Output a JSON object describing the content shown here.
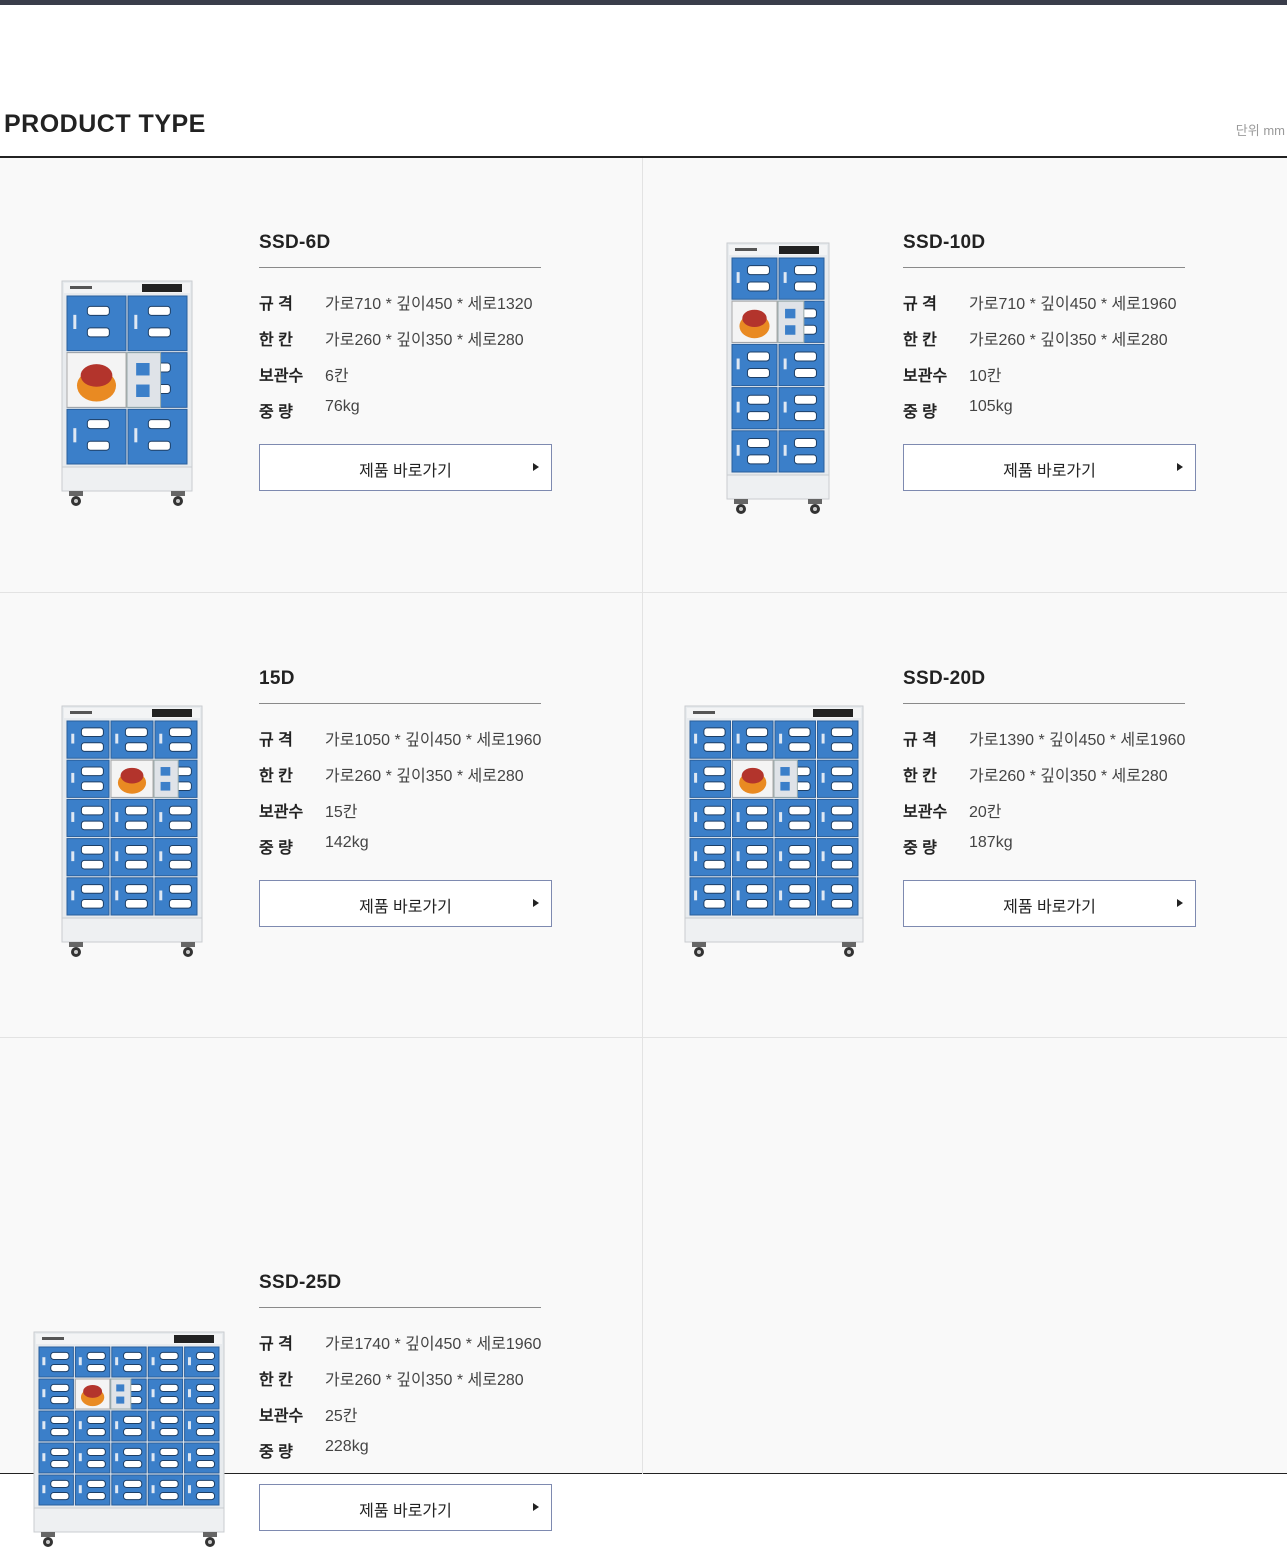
{
  "header": {
    "title": "PRODUCT TYPE",
    "unit": "단위 mm"
  },
  "labels": {
    "size": "규 격",
    "compartment": "한 칸",
    "storage": "보관수",
    "weight": "중 량"
  },
  "products": [
    {
      "name": "SSD-6D",
      "size": "가로710 * 깊이450 * 세로1320",
      "compartment": "가로260 * 깊이350 * 세로280",
      "storage": "6칸",
      "weight": "76kg",
      "button": "제품 바로가기",
      "cols": 2,
      "rows": 3
    },
    {
      "name": "SSD-10D",
      "size": "가로710 * 깊이450 * 세로1960",
      "compartment": "가로260 * 깊이350 * 세로280",
      "storage": "10칸",
      "weight": "105kg",
      "button": "제품 바로가기",
      "cols": 2,
      "rows": 5
    },
    {
      "name": "15D",
      "size": "가로1050 * 깊이450 * 세로1960",
      "compartment": "가로260 * 깊이350 * 세로280",
      "storage": "15칸",
      "weight": "142kg",
      "button": "제품 바로가기",
      "cols": 3,
      "rows": 5
    },
    {
      "name": "SSD-20D",
      "size": "가로1390 * 깊이450 * 세로1960",
      "compartment": "가로260 * 깊이350 * 세로280",
      "storage": "20칸",
      "weight": "187kg",
      "button": "제품 바로가기",
      "cols": 4,
      "rows": 5
    },
    {
      "name": "SSD-25D",
      "size": "가로1740 * 깊이450 * 세로1960",
      "compartment": "가로260 * 깊이350 * 세로280",
      "storage": "25칸",
      "weight": "228kg",
      "button": "제품 바로가기",
      "cols": 5,
      "rows": 5
    }
  ],
  "colors": {
    "locker_blue": "#3b7fc9",
    "frame": "#e8ebee",
    "border": "#7e8ab0"
  },
  "icons": {
    "button_arrow": "triangle-right-icon"
  }
}
